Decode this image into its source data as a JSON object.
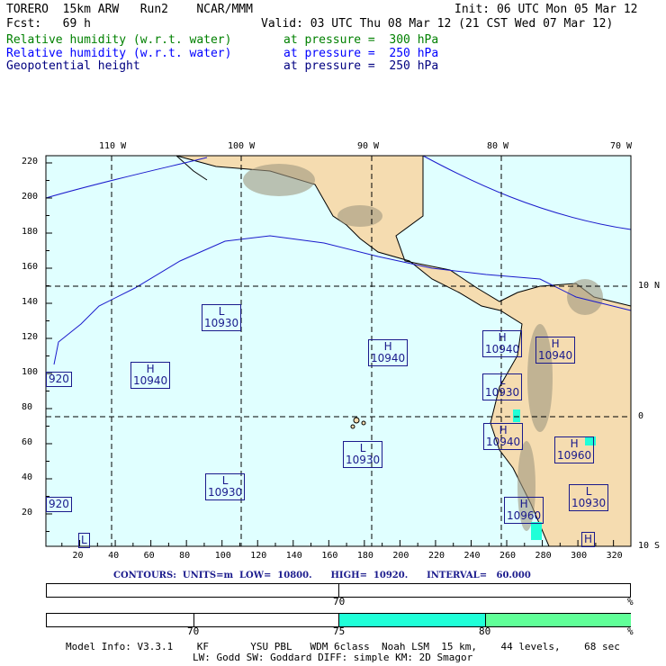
{
  "header": {
    "model": "TORERO  15km ARW   Run2    NCAR/MMM",
    "init": "Init: 06 UTC Mon 05 Mar 12",
    "fcst": "Fcst:   69 h",
    "valid": "Valid: 03 UTC Thu 08 Mar 12 (21 CST Wed 07 Mar 12)",
    "fields": [
      {
        "name": "Relative humidity (w.r.t. water)",
        "level": "at pressure =  300 hPa",
        "color": "#008000"
      },
      {
        "name": "Relative humidity (w.r.t. water)",
        "level": "at pressure =  250 hPa",
        "color": "#0000ff"
      },
      {
        "name": "Geopotential height",
        "level": "at pressure =  250 hPa",
        "color": "#000080"
      }
    ]
  },
  "map": {
    "lon_labels": [
      "110 W",
      "100 W",
      "90 W",
      "80 W",
      "70 W"
    ],
    "lat_labels": [
      "10 N",
      "0",
      "10 S"
    ],
    "x_ticks": [
      "20",
      "40",
      "60",
      "80",
      "100",
      "120",
      "140",
      "160",
      "180",
      "200",
      "220",
      "240",
      "260",
      "280",
      "300",
      "320"
    ],
    "y_ticks": [
      "220",
      "200",
      "180",
      "160",
      "140",
      "120",
      "100",
      "80",
      "60",
      "40",
      "20"
    ],
    "contour_labels": [
      {
        "type": "L",
        "value": "10930"
      },
      {
        "type": "H",
        "value": "10940"
      },
      {
        "type": "",
        "value": "920"
      },
      {
        "type": "H",
        "value": "10940"
      },
      {
        "type": "L",
        "value": "10930"
      },
      {
        "type": "L",
        "value": "10930"
      },
      {
        "type": "",
        "value": "920"
      },
      {
        "type": "L",
        "value": ""
      },
      {
        "type": "H",
        "value": "10940"
      },
      {
        "type": "H",
        "value": "10940"
      },
      {
        "type": "L",
        "value": "10930"
      },
      {
        "type": "H",
        "value": "10940"
      },
      {
        "type": "H",
        "value": "10960"
      },
      {
        "type": "H",
        "value": "10960"
      },
      {
        "type": "L",
        "value": "10930"
      },
      {
        "type": "H",
        "value": ""
      }
    ]
  },
  "contours_info": "CONTOURS:  UNITS=m  LOW=  10800.      HIGH=  10920.      INTERVAL=   60.000",
  "colorbar1": {
    "labels": [
      "70",
      "%"
    ]
  },
  "colorbar2": {
    "labels": [
      "70",
      "75",
      "80",
      "%"
    ],
    "colors": [
      "#ffffff",
      "#ffffff",
      "#20ffd8",
      "#60ff98"
    ]
  },
  "footer": {
    "line1": "Model Info: V3.3.1    KF       YSU PBL   WDM 6class  Noah LSM  15 km,    44 levels,    68 sec",
    "line2": "LW: Godd SW: Goddard DIFF: simple KM: 2D Smagor"
  }
}
